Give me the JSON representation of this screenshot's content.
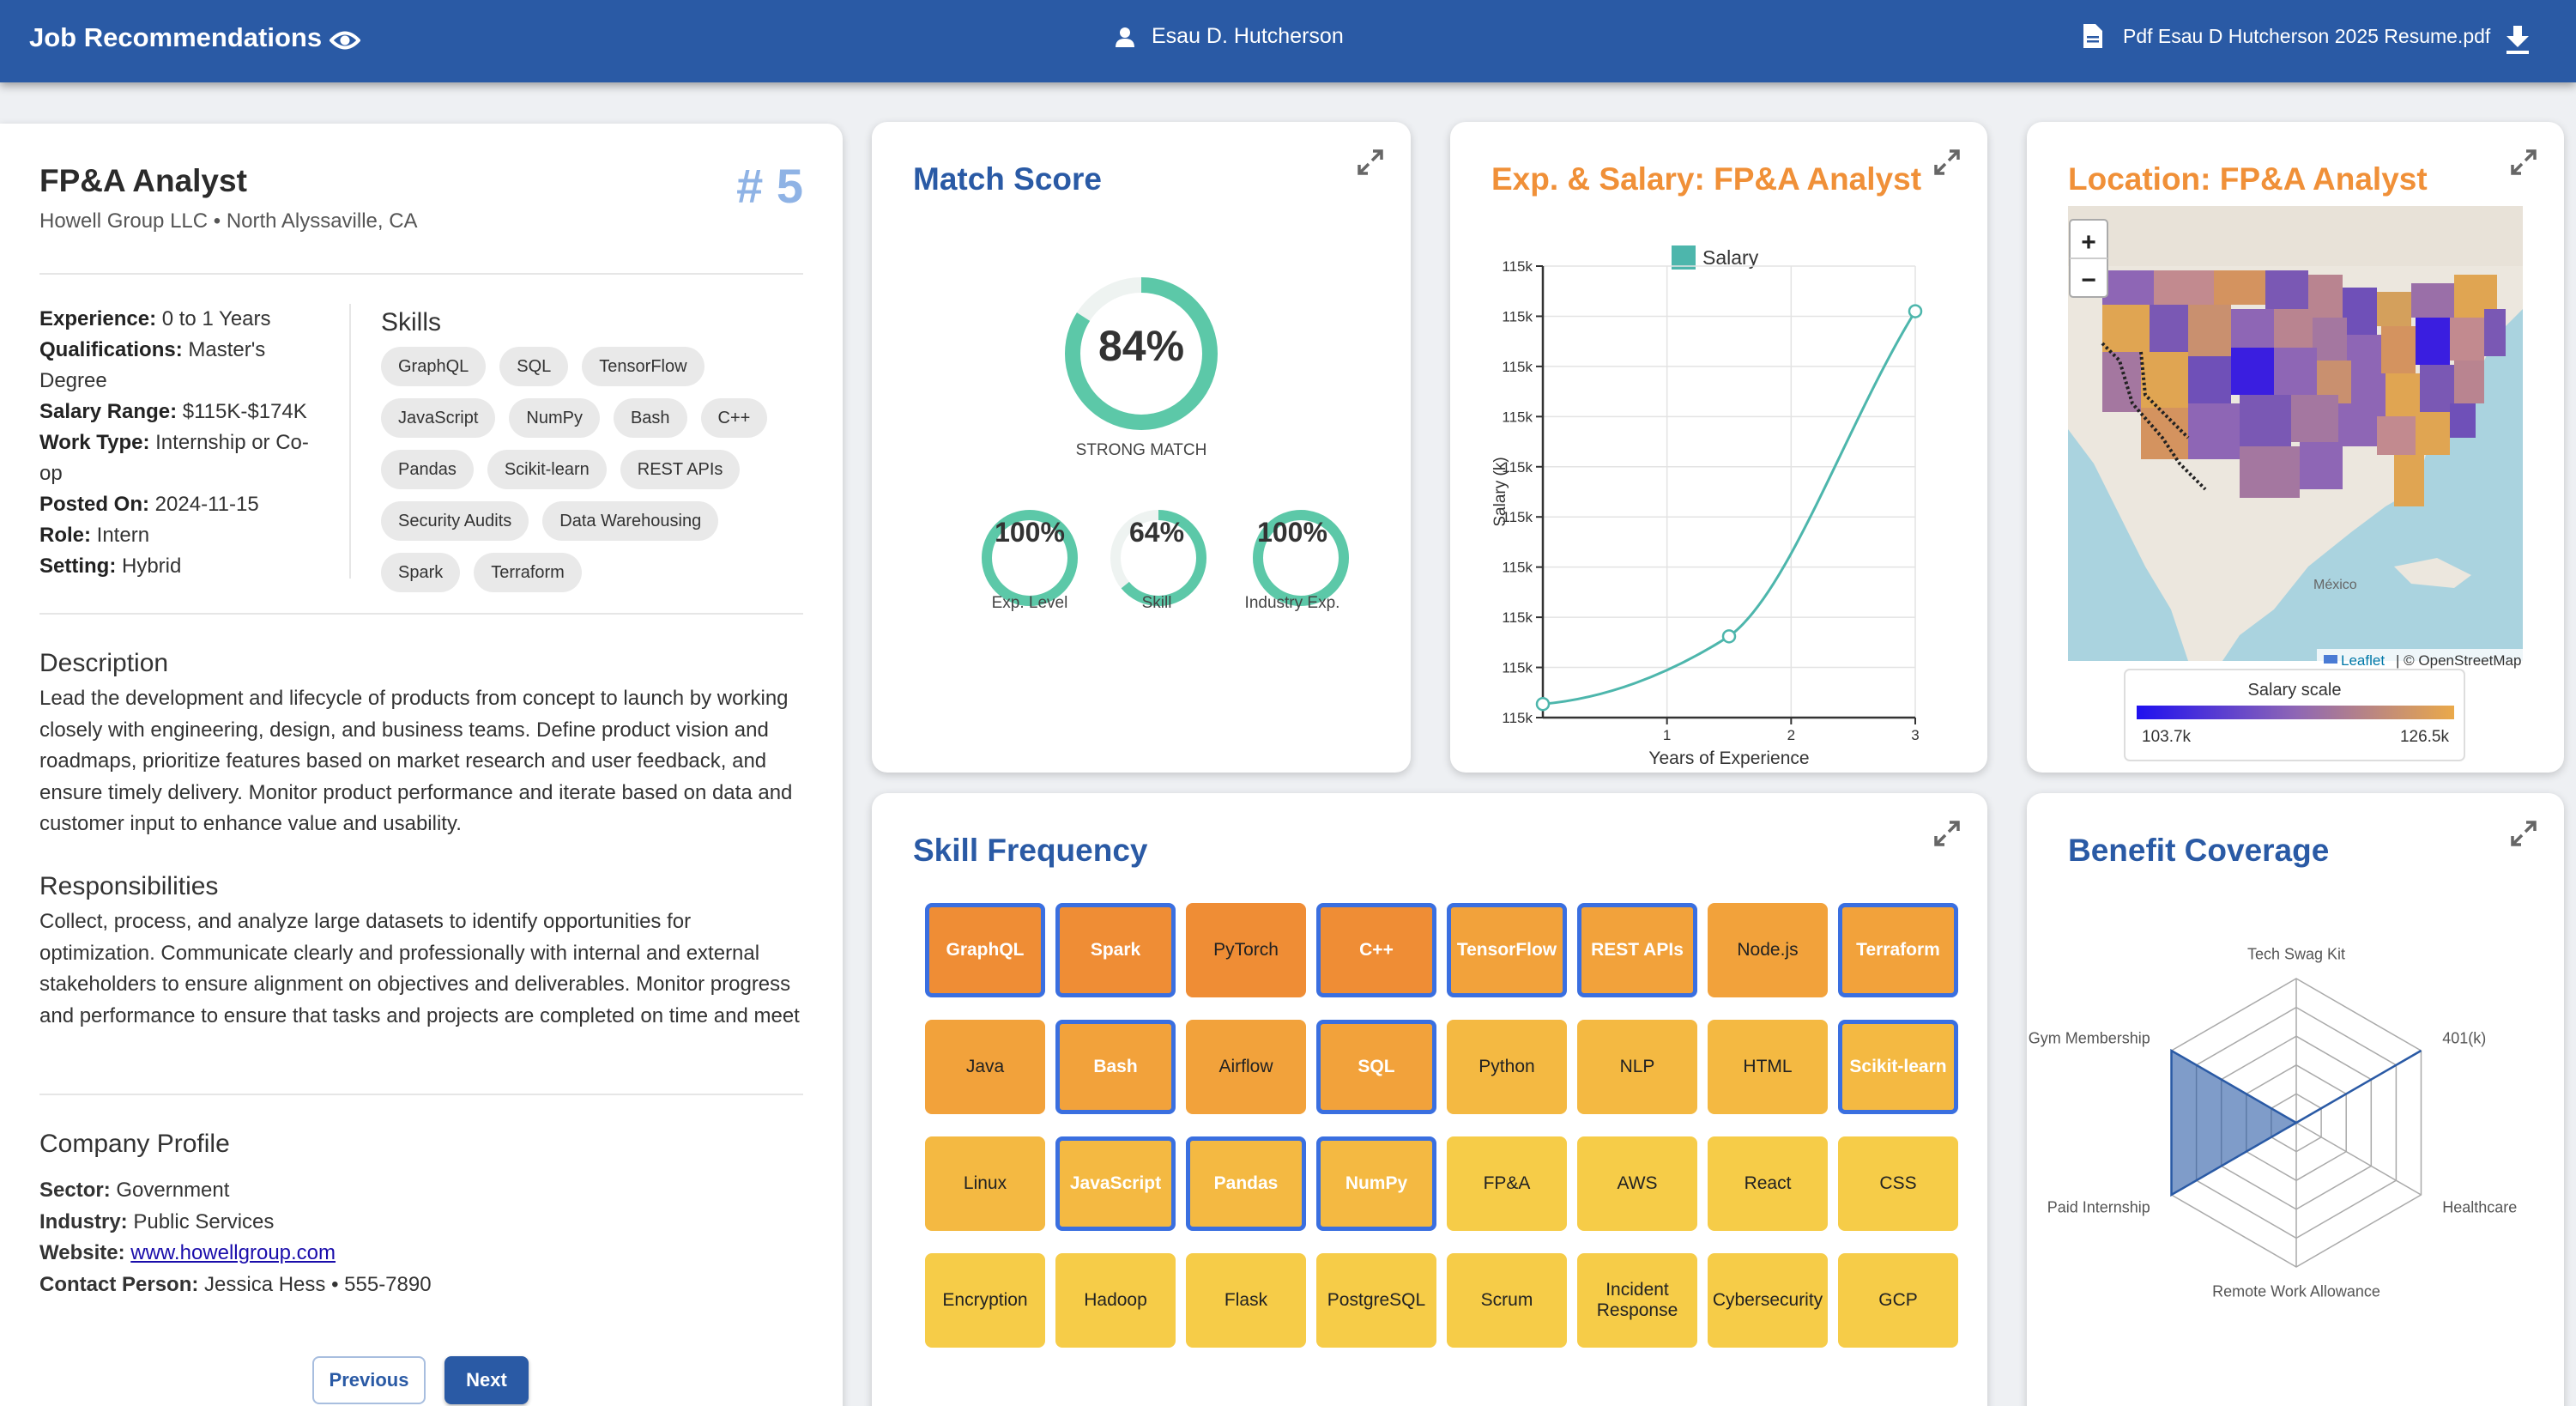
{
  "header": {
    "app_title": "Job Recommendations",
    "user_name": "Esau D. Hutcherson",
    "resume_file": "Pdf Esau D Hutcherson 2025 Resume.pdf"
  },
  "job": {
    "title": "FP&A Analyst",
    "company_line": "Howell Group LLC • North Alyssaville, CA",
    "rank": "# 5",
    "details": [
      {
        "label": "Experience:",
        "value": "0 to 1 Years"
      },
      {
        "label": "Qualifications:",
        "value": "Master's Degree"
      },
      {
        "label": "Salary Range:",
        "value": "$115K-$174K"
      },
      {
        "label": "Work Type:",
        "value": "Internship or Co-op"
      },
      {
        "label": "Posted On:",
        "value": "2024-11-15"
      },
      {
        "label": "Role:",
        "value": "Intern"
      },
      {
        "label": "Setting:",
        "value": "Hybrid"
      }
    ],
    "skills_heading": "Skills",
    "skills": [
      "GraphQL",
      "SQL",
      "TensorFlow",
      "JavaScript",
      "NumPy",
      "Bash",
      "C++",
      "Pandas",
      "Scikit-learn",
      "REST APIs",
      "Security Audits",
      "Data Warehousing",
      "Spark",
      "Terraform"
    ],
    "description_heading": "Description",
    "description": "Lead the development and lifecycle of products from concept to launch by working closely with engineering, design, and business teams. Define product vision and roadmaps, prioritize features based on market research and user feedback, and ensure timely delivery. Monitor product performance and iterate based on data and customer input to enhance value and usability.",
    "responsibilities_heading": "Responsibilities",
    "responsibilities": "Collect, process, and analyze large datasets to identify opportunities for optimization. Communicate clearly and professionally with internal and external stakeholders to ensure alignment on objectives and deliverables. Monitor progress and performance to ensure that tasks and projects are completed on time and meet quality standards. Identify and resolve issues proactively by",
    "company_heading": "Company Profile",
    "company": {
      "sector_label": "Sector:",
      "sector": "Government",
      "industry_label": "Industry:",
      "industry": "Public Services",
      "website_label": "Website:",
      "website": "www.howellgroup.com",
      "contact_label": "Contact Person:",
      "contact": "Jessica Hess • 555-7890"
    },
    "prev_label": "Previous",
    "next_label": "Next"
  },
  "match": {
    "title": "Match Score",
    "overall": {
      "value": 84,
      "text": "84%",
      "label": "STRONG MATCH"
    },
    "sub": [
      {
        "value": 100,
        "text": "100%",
        "label": "Exp. Level"
      },
      {
        "value": 64,
        "text": "64%",
        "label": "Skill"
      },
      {
        "value": 100,
        "text": "100%",
        "label": "Industry Exp."
      }
    ],
    "color": "#5cc8a8"
  },
  "chart_data": {
    "type": "line",
    "title": "Exp. & Salary: FP&A Analyst",
    "xlabel": "Years of Experience",
    "ylabel": "Salary (k)",
    "x_ticks": [
      "1",
      "2",
      "3"
    ],
    "y_ticks": [
      "115k",
      "115k",
      "115k",
      "115k",
      "115k",
      "115k",
      "115k",
      "115k",
      "115k",
      "115k"
    ],
    "legend": "Salary",
    "legend_placement": "top",
    "x_range": [
      0,
      3
    ],
    "points": [
      {
        "x": 0,
        "y": 0.03
      },
      {
        "x": 1.5,
        "y": 0.18
      },
      {
        "x": 3,
        "y": 0.9
      }
    ],
    "color": "#4db6ac"
  },
  "location": {
    "title": "Location: FP&A Analyst",
    "zoom_in": "+",
    "zoom_out": "−",
    "mexico_label": "México",
    "attribution_leaflet": "Leaflet",
    "attribution_osm": "| © OpenStreetMap",
    "legend_title": "Salary scale",
    "legend_min": "103.7k",
    "legend_max": "126.5k"
  },
  "skill_frequency": {
    "title": "Skill Frequency",
    "rows": [
      [
        {
          "name": "GraphQL",
          "hl": true
        },
        {
          "name": "Spark",
          "hl": true
        },
        {
          "name": "PyTorch",
          "hl": false
        },
        {
          "name": "C++",
          "hl": true
        },
        {
          "name": "TensorFlow",
          "hl": true
        },
        {
          "name": "REST APIs",
          "hl": true
        },
        {
          "name": "Node.js",
          "hl": false
        },
        {
          "name": "Terraform",
          "hl": true
        }
      ],
      [
        {
          "name": "Java",
          "hl": false
        },
        {
          "name": "Bash",
          "hl": true
        },
        {
          "name": "Airflow",
          "hl": false
        },
        {
          "name": "SQL",
          "hl": true
        },
        {
          "name": "Python",
          "hl": false
        },
        {
          "name": "NLP",
          "hl": false
        },
        {
          "name": "HTML",
          "hl": false
        },
        {
          "name": "Scikit-learn",
          "hl": true
        }
      ],
      [
        {
          "name": "Linux",
          "hl": false
        },
        {
          "name": "JavaScript",
          "hl": true
        },
        {
          "name": "Pandas",
          "hl": true
        },
        {
          "name": "NumPy",
          "hl": true
        },
        {
          "name": "FP&A",
          "hl": false
        },
        {
          "name": "AWS",
          "hl": false
        },
        {
          "name": "React",
          "hl": false
        },
        {
          "name": "CSS",
          "hl": false
        }
      ],
      [
        {
          "name": "Encryption",
          "hl": false
        },
        {
          "name": "Hadoop",
          "hl": false
        },
        {
          "name": "Flask",
          "hl": false
        },
        {
          "name": "PostgreSQL",
          "hl": false
        },
        {
          "name": "Scrum",
          "hl": false
        },
        {
          "name": "Incident Response",
          "hl": false
        },
        {
          "name": "Cybersecurity",
          "hl": false
        },
        {
          "name": "GCP",
          "hl": false
        }
      ]
    ],
    "colors": [
      "#ef8d35",
      "#f2a23b",
      "#f4b942",
      "#f6cc48"
    ],
    "highlight_border": "#3a6fe0"
  },
  "benefits": {
    "title": "Benefit Coverage",
    "axes": [
      "Tech Swag Kit",
      "401(k)",
      "Healthcare",
      "Remote Work Allowance",
      "Paid Internship",
      "Gym Membership"
    ],
    "values": [
      0,
      0,
      0,
      0,
      1,
      1
    ],
    "color": "#2a5aa5"
  }
}
